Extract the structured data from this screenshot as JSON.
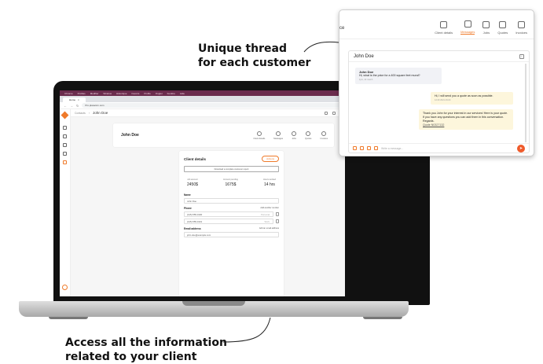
{
  "captions": {
    "top_line1": "Unique thread",
    "top_line2": "for each customer",
    "bottom_line1": "Access all the information",
    "bottom_line2": "related to your client"
  },
  "browser": {
    "os_menu": [
      "Chrome",
      "Profiles",
      "Modifier",
      "Window",
      "Historique",
      "Favoris",
      "Profils",
      "Onglet",
      "Fenêtre",
      "Aide"
    ],
    "tab_label": "Home",
    "url": "Pro.planetcm.com"
  },
  "app": {
    "breadcrumb": "Contacts",
    "customer_title": "John Doe",
    "customer_card": {
      "name": "John Doe",
      "actions": [
        "Client details",
        "Messages",
        "Jobs",
        "Quotes",
        "Invoices"
      ]
    },
    "details": {
      "title": "Client details",
      "actions_label": "Actions",
      "download_label": "Download a complete customer report",
      "stats": [
        {
          "label": "Job amount",
          "value": "2450$"
        },
        {
          "label": "Amount pending",
          "value": "1675$"
        },
        {
          "label": "Hours worked",
          "value": "14 hrs"
        }
      ],
      "name_label": "Name",
      "name_value": "John Doe",
      "phone_label": "Phone",
      "phone_add": "Add another number",
      "phones": [
        {
          "number": "(415) 555-0100",
          "type": "Personal"
        },
        {
          "number": "(415) 555-0101",
          "type": "Work"
        }
      ],
      "email_label": "Email address",
      "email_add": "Add an email address",
      "email_value": "john.doe@example.com"
    }
  },
  "popup": {
    "tabs": [
      "Client details",
      "Messages",
      "Jobs",
      "Quotes",
      "Invoices"
    ],
    "active_tab": "Messages",
    "edge_text": "ce",
    "chat": {
      "name": "John Doe",
      "info_glyph": "i",
      "msg1_author": "John Doe",
      "msg1_text": "Hi, what is the price for a 400 square feet mural?",
      "msg1_meta": "1pm, 22 march",
      "msg2_text": "Hi, I will send you a quote as soon as possible.",
      "msg2_meta": "12:40 2021-04-04",
      "msg3_text": "Thank you John for your interest in our services! Here is your quote. If you have any questions you can add them in this conversation. Regards.",
      "msg3_link": "Quote N0327132",
      "compose_placeholder": "Write a message...",
      "send_glyph": "➤"
    }
  },
  "colors": {
    "accent": "#ef7a2a",
    "menubar": "#6b2c4d"
  }
}
